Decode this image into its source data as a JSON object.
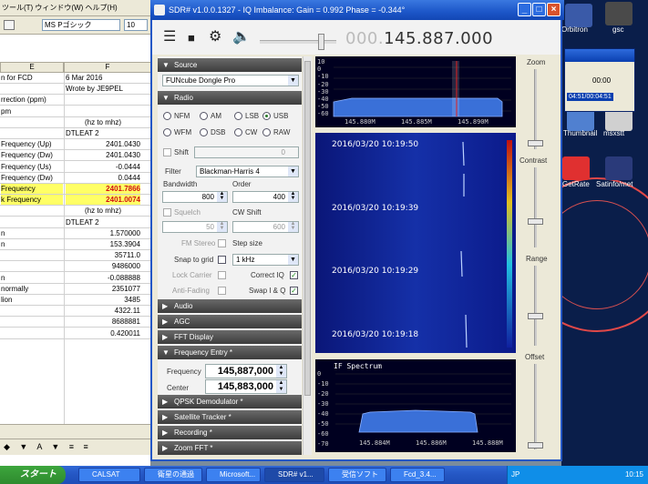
{
  "excel": {
    "menu": "ツール(T)  ウィンドウ(W)  ヘルプ(H)",
    "font_name": "MS Pゴシック",
    "font_size": "10",
    "col_e": "E",
    "col_f": "F",
    "cells": [
      {
        "a": "n for FCD",
        "b": "6 Mar 2016"
      },
      {
        "a": "",
        "b": "Wrote by JE9PEL"
      },
      {
        "a": "rrection (ppm)",
        "b": ""
      },
      {
        "a": "pm",
        "b": ""
      },
      {
        "a": "",
        "b": "(hz to mhz)"
      },
      {
        "a": "",
        "b": "DTLEAT 2"
      },
      {
        "a": "Frequency (Up)",
        "b": "2401.0430"
      },
      {
        "a": "Frequency (Dw)",
        "b": "2401.0430"
      },
      {
        "a": "Frequency (Us)",
        "b": "-0.0444"
      },
      {
        "a": "Frequency (Dw)",
        "b": "0.0444"
      },
      {
        "a": "Frequency",
        "b": "2401.7866"
      },
      {
        "a": "k Frequency",
        "b": "2401.0074"
      },
      {
        "a": "",
        "b": "(hz to mhz)"
      },
      {
        "a": "",
        "b": "DTLEAT 2"
      },
      {
        "a": "n",
        "b": "1.570000"
      },
      {
        "a": "n",
        "b": "153.3904"
      },
      {
        "a": "",
        "b": "35711.0"
      },
      {
        "a": "",
        "b": "9486000"
      },
      {
        "a": "n",
        "b": "-0.088888"
      },
      {
        "a": "normally",
        "b": "2351077"
      },
      {
        "a": "lion",
        "b": "3485"
      },
      {
        "a": "",
        "b": "4322.11"
      },
      {
        "a": "",
        "b": "8688881"
      },
      {
        "a": "",
        "b": "0.420011"
      }
    ],
    "draw_toolbar": "◆ ▼ A ▼ ≡ ≡"
  },
  "sdr": {
    "title": "SDR# v1.0.0.1327 - IQ Imbalance: Gain = 0.992 Phase = -0.344°",
    "freq_dim": "000.",
    "freq_main": "145.887.000",
    "sections": {
      "source": "Source",
      "radio": "Radio",
      "audio": "Audio",
      "agc": "AGC",
      "fft": "FFT Display",
      "freq_entry": "Frequency Entry *",
      "qpsk": "QPSK Demodulator *",
      "sat": "Satellite Tracker *",
      "rec": "Recording *",
      "zoom": "Zoom FFT *"
    },
    "source_value": "FUNcube Dongle Pro",
    "modes": [
      "NFM",
      "AM",
      "LSB",
      "USB",
      "WFM",
      "DSB",
      "CW",
      "RAW"
    ],
    "selected_mode": "USB",
    "shift_label": "Shift",
    "shift_value": "0",
    "filter_label": "Filter",
    "filter_value": "Blackman-Harris 4",
    "bandwidth_label": "Bandwidth",
    "bandwidth_value": "800",
    "order_label": "Order",
    "order_value": "400",
    "squelch_label": "Squelch",
    "squelch_value": "50",
    "cwshift_label": "CW Shift",
    "cwshift_value": "600",
    "fmstereo_label": "FM Stereo",
    "stepsize_label": "Step size",
    "snap_label": "Snap to grid",
    "snap_value": "1 kHz",
    "lockcarrier_label": "Lock Carrier",
    "correctiq_label": "Correct IQ",
    "antifading_label": "Anti-Fading",
    "swapiq_label": "Swap I & Q",
    "frequency_label": "Frequency",
    "frequency_value": "145,887,000",
    "center_label": "Center",
    "center_value": "145,883,000",
    "zoom_label": "Zoom",
    "contrast_label": "Contrast",
    "range_label": "Range",
    "offset_label": "Offset",
    "spec_yaxis": [
      "10",
      "0",
      "-10",
      "-20",
      "-30",
      "-40",
      "-50",
      "-60"
    ],
    "spec_xaxis": [
      "145.880M",
      "145.885M",
      "145.890M"
    ],
    "waterfall_times": [
      "2016/03/20 10:19:50",
      "2016/03/20 10:19:39",
      "2016/03/20 10:19:29",
      "2016/03/20 10:19:18"
    ],
    "if_title": "IF Spectrum",
    "if_yaxis": [
      "0",
      "-10",
      "-20",
      "-30",
      "-40",
      "-50",
      "-60",
      "-70"
    ],
    "if_xaxis": [
      "145.884M",
      "145.886M",
      "145.888M"
    ]
  },
  "desktop": {
    "icons": [
      "Orbitron",
      "gsc",
      "Thumbnail",
      "msxstt",
      "GetRate",
      "Satinfo/met"
    ],
    "mini_time": "00:00",
    "mini_window": "04:51/00:04:51"
  },
  "taskbar": {
    "start": "スタート",
    "tasks": [
      "CALSAT",
      "衛星の通過",
      "Microsoft...",
      "SDR# v1...",
      "受信ソフト",
      "Fcd_3.4..."
    ],
    "tray_lang": "JP",
    "clock": "10:15"
  }
}
